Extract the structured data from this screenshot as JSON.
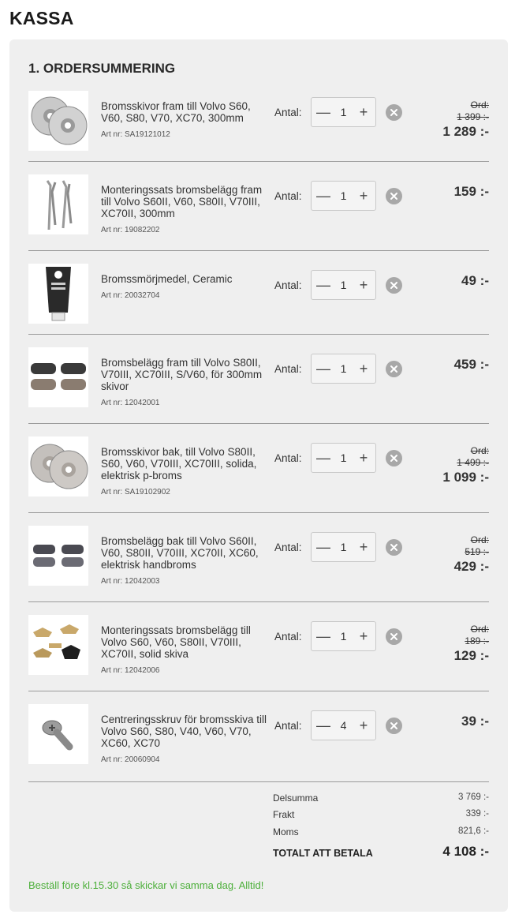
{
  "page": {
    "title": "KASSA"
  },
  "section": {
    "title": "1. ORDERSUMMERING"
  },
  "qty_label": "Antal:",
  "old_price_label": "Ord:",
  "items": [
    {
      "name": "Bromsskivor fram till Volvo S60, V60, S80, V70, XC70, 300mm",
      "art_label": "Art nr: SA19121012",
      "qty": "1",
      "old_price": "1 399 :-",
      "price": "1 289 :-",
      "image": "brake-discs-front"
    },
    {
      "name": "Monteringssats bromsbelägg fram till Volvo S60II, V60, S80II, V70III, XC70II, 300mm",
      "art_label": "Art nr: 19082202",
      "qty": "1",
      "old_price": "",
      "price": "159 :-",
      "image": "mounting-kit"
    },
    {
      "name": "Bromssmörjmedel, Ceramic",
      "art_label": "Art nr: 20032704",
      "qty": "1",
      "old_price": "",
      "price": "49 :-",
      "image": "lubricant-tube"
    },
    {
      "name": "Bromsbelägg fram till Volvo S80II, V70III, XC70III, S/V60, för 300mm skivor",
      "art_label": "Art nr: 12042001",
      "qty": "1",
      "old_price": "",
      "price": "459 :-",
      "image": "brake-pads"
    },
    {
      "name": "Bromsskivor bak, till Volvo S80II, S60, V60, V70III, XC70III, solida, elektrisk p-broms",
      "art_label": "Art nr: SA19102902",
      "qty": "1",
      "old_price": "1 499 :-",
      "price": "1 099 :-",
      "image": "brake-discs-rear"
    },
    {
      "name": "Bromsbelägg bak till Volvo S60II, V60, S80II, V70III, XC70II, XC60, elektrisk handbroms",
      "art_label": "Art nr: 12042003",
      "qty": "1",
      "old_price": "519 :-",
      "price": "429 :-",
      "image": "brake-pads-rear"
    },
    {
      "name": "Monteringssats bromsbelägg till Volvo S60, V60, S80II, V70III, XC70II, solid skiva",
      "art_label": "Art nr: 12042006",
      "qty": "1",
      "old_price": "189 :-",
      "price": "129 :-",
      "image": "clips-kit"
    },
    {
      "name": "Centreringsskruv för bromsskiva till Volvo S60, S80, V40, V60, V70, XC60, XC70",
      "art_label": "Art nr: 20060904",
      "qty": "4",
      "old_price": "",
      "price": "39 :-",
      "image": "screw"
    }
  ],
  "totals": {
    "subtotal_label": "Delsumma",
    "subtotal": "3 769 :-",
    "shipping_label": "Frakt",
    "shipping": "339 :-",
    "vat_label": "Moms",
    "vat": "821,6 :-",
    "grand_label": "TOTALT ATT BETALA",
    "grand": "4 108 :-"
  },
  "notice": "Beställ före kl.15.30 så skickar vi samma dag. Alltid!",
  "colors": {
    "panel": "#efefef",
    "notice": "#4caf3a",
    "remove": "#a8a8a8"
  }
}
